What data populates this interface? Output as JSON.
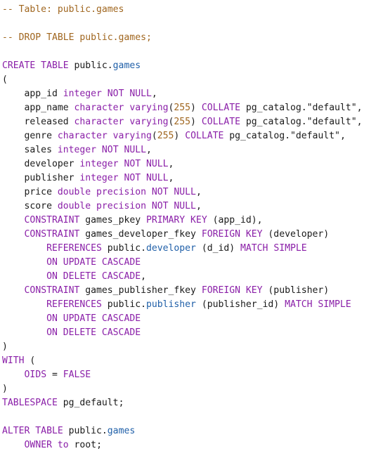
{
  "editor": {
    "colors": {
      "comment": "#a0661f",
      "keyword": "#8a1fa8",
      "type": "#8a1fa8",
      "ident": "#1a1a1a",
      "table": "#1f5fa8",
      "number": "#a0661f",
      "string": "#1a1a1a",
      "punct": "#1a1a1a"
    },
    "lines": [
      [
        [
          "comment",
          "-- Table: public.games"
        ]
      ],
      [],
      [
        [
          "comment",
          "-- DROP TABLE public.games;"
        ]
      ],
      [],
      [
        [
          "keyword",
          "CREATE TABLE "
        ],
        [
          "ident",
          "public."
        ],
        [
          "table",
          "games"
        ]
      ],
      [
        [
          "punct",
          "("
        ]
      ],
      [
        [
          "ident",
          "    app_id "
        ],
        [
          "type",
          "integer "
        ],
        [
          "keyword",
          "NOT NULL"
        ],
        [
          "punct",
          ","
        ]
      ],
      [
        [
          "ident",
          "    app_name "
        ],
        [
          "type",
          "character varying"
        ],
        [
          "punct",
          "("
        ],
        [
          "number",
          "255"
        ],
        [
          "punct",
          ") "
        ],
        [
          "keyword",
          "COLLATE "
        ],
        [
          "ident",
          "pg_catalog."
        ],
        [
          "string",
          "\"default\""
        ],
        [
          "punct",
          ","
        ]
      ],
      [
        [
          "ident",
          "    released "
        ],
        [
          "type",
          "character varying"
        ],
        [
          "punct",
          "("
        ],
        [
          "number",
          "255"
        ],
        [
          "punct",
          ") "
        ],
        [
          "keyword",
          "COLLATE "
        ],
        [
          "ident",
          "pg_catalog."
        ],
        [
          "string",
          "\"default\""
        ],
        [
          "punct",
          ","
        ]
      ],
      [
        [
          "ident",
          "    genre "
        ],
        [
          "type",
          "character varying"
        ],
        [
          "punct",
          "("
        ],
        [
          "number",
          "255"
        ],
        [
          "punct",
          ") "
        ],
        [
          "keyword",
          "COLLATE "
        ],
        [
          "ident",
          "pg_catalog."
        ],
        [
          "string",
          "\"default\""
        ],
        [
          "punct",
          ","
        ]
      ],
      [
        [
          "ident",
          "    sales "
        ],
        [
          "type",
          "integer "
        ],
        [
          "keyword",
          "NOT NULL"
        ],
        [
          "punct",
          ","
        ]
      ],
      [
        [
          "ident",
          "    developer "
        ],
        [
          "type",
          "integer "
        ],
        [
          "keyword",
          "NOT NULL"
        ],
        [
          "punct",
          ","
        ]
      ],
      [
        [
          "ident",
          "    publisher "
        ],
        [
          "type",
          "integer "
        ],
        [
          "keyword",
          "NOT NULL"
        ],
        [
          "punct",
          ","
        ]
      ],
      [
        [
          "ident",
          "    price "
        ],
        [
          "type",
          "double precision "
        ],
        [
          "keyword",
          "NOT NULL"
        ],
        [
          "punct",
          ","
        ]
      ],
      [
        [
          "ident",
          "    score "
        ],
        [
          "type",
          "double precision "
        ],
        [
          "keyword",
          "NOT NULL"
        ],
        [
          "punct",
          ","
        ]
      ],
      [
        [
          "ident",
          "    "
        ],
        [
          "keyword",
          "CONSTRAINT "
        ],
        [
          "ident",
          "games_pkey "
        ],
        [
          "keyword",
          "PRIMARY KEY "
        ],
        [
          "punct",
          "(app_id),"
        ]
      ],
      [
        [
          "ident",
          "    "
        ],
        [
          "keyword",
          "CONSTRAINT "
        ],
        [
          "ident",
          "games_developer_fkey "
        ],
        [
          "keyword",
          "FOREIGN KEY "
        ],
        [
          "punct",
          "(developer)"
        ]
      ],
      [
        [
          "ident",
          "        "
        ],
        [
          "keyword",
          "REFERENCES "
        ],
        [
          "ident",
          "public."
        ],
        [
          "table",
          "developer "
        ],
        [
          "punct",
          "(d_id) "
        ],
        [
          "keyword",
          "MATCH SIMPLE"
        ]
      ],
      [
        [
          "ident",
          "        "
        ],
        [
          "keyword",
          "ON UPDATE CASCADE"
        ]
      ],
      [
        [
          "ident",
          "        "
        ],
        [
          "keyword",
          "ON DELETE CASCADE"
        ],
        [
          "punct",
          ","
        ]
      ],
      [
        [
          "ident",
          "    "
        ],
        [
          "keyword",
          "CONSTRAINT "
        ],
        [
          "ident",
          "games_publisher_fkey "
        ],
        [
          "keyword",
          "FOREIGN KEY "
        ],
        [
          "punct",
          "(publisher)"
        ]
      ],
      [
        [
          "ident",
          "        "
        ],
        [
          "keyword",
          "REFERENCES "
        ],
        [
          "ident",
          "public."
        ],
        [
          "table",
          "publisher "
        ],
        [
          "punct",
          "(publisher_id) "
        ],
        [
          "keyword",
          "MATCH SIMPLE"
        ]
      ],
      [
        [
          "ident",
          "        "
        ],
        [
          "keyword",
          "ON UPDATE CASCADE"
        ]
      ],
      [
        [
          "ident",
          "        "
        ],
        [
          "keyword",
          "ON DELETE CASCADE"
        ]
      ],
      [
        [
          "punct",
          ")"
        ]
      ],
      [
        [
          "keyword",
          "WITH "
        ],
        [
          "punct",
          "("
        ]
      ],
      [
        [
          "ident",
          "    "
        ],
        [
          "keyword",
          "OIDS "
        ],
        [
          "punct",
          "= "
        ],
        [
          "keyword",
          "FALSE"
        ]
      ],
      [
        [
          "punct",
          ")"
        ]
      ],
      [
        [
          "keyword",
          "TABLESPACE "
        ],
        [
          "ident",
          "pg_default"
        ],
        [
          "punct",
          ";"
        ]
      ],
      [],
      [
        [
          "keyword",
          "ALTER TABLE "
        ],
        [
          "ident",
          "public."
        ],
        [
          "table",
          "games"
        ]
      ],
      [
        [
          "ident",
          "    "
        ],
        [
          "keyword",
          "OWNER "
        ],
        [
          "keyword",
          "to "
        ],
        [
          "ident",
          "root"
        ],
        [
          "punct",
          ";"
        ]
      ]
    ]
  }
}
